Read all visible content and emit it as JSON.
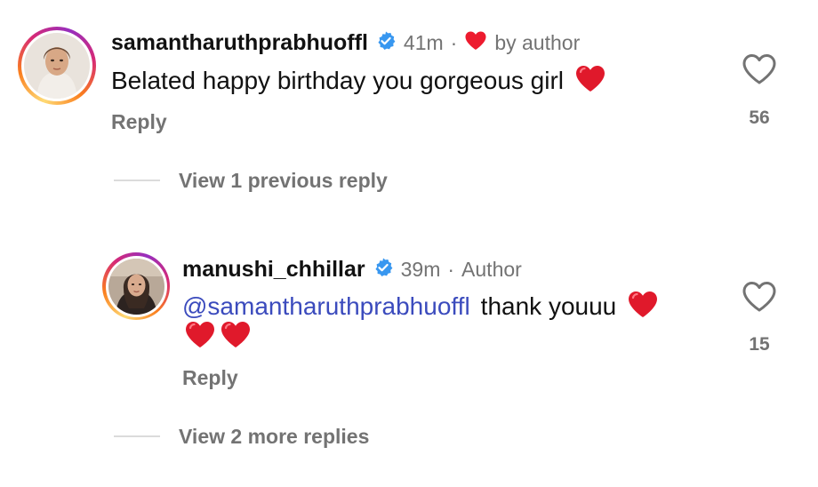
{
  "comment": {
    "username": "samantharuthprabhuoffl",
    "time": "41m",
    "separator": "·",
    "liked_by": "by author",
    "text": "Belated happy birthday you gorgeous girl",
    "emoji_heart": "red-heart-emoji",
    "reply_label": "Reply",
    "like_count": "56"
  },
  "view_previous": "View 1 previous reply",
  "reply": {
    "username": "manushi_chhillar",
    "time": "39m",
    "separator": "·",
    "badge": "Author",
    "mention": "@samantharuthprabhuoffl",
    "text": "thank youuu",
    "reply_label": "Reply",
    "like_count": "15"
  },
  "view_more": "View 2 more replies",
  "colors": {
    "verified": "#3897f0",
    "heart": "#ed1b2e",
    "muted": "#737373",
    "mention": "#3b4bbd"
  }
}
